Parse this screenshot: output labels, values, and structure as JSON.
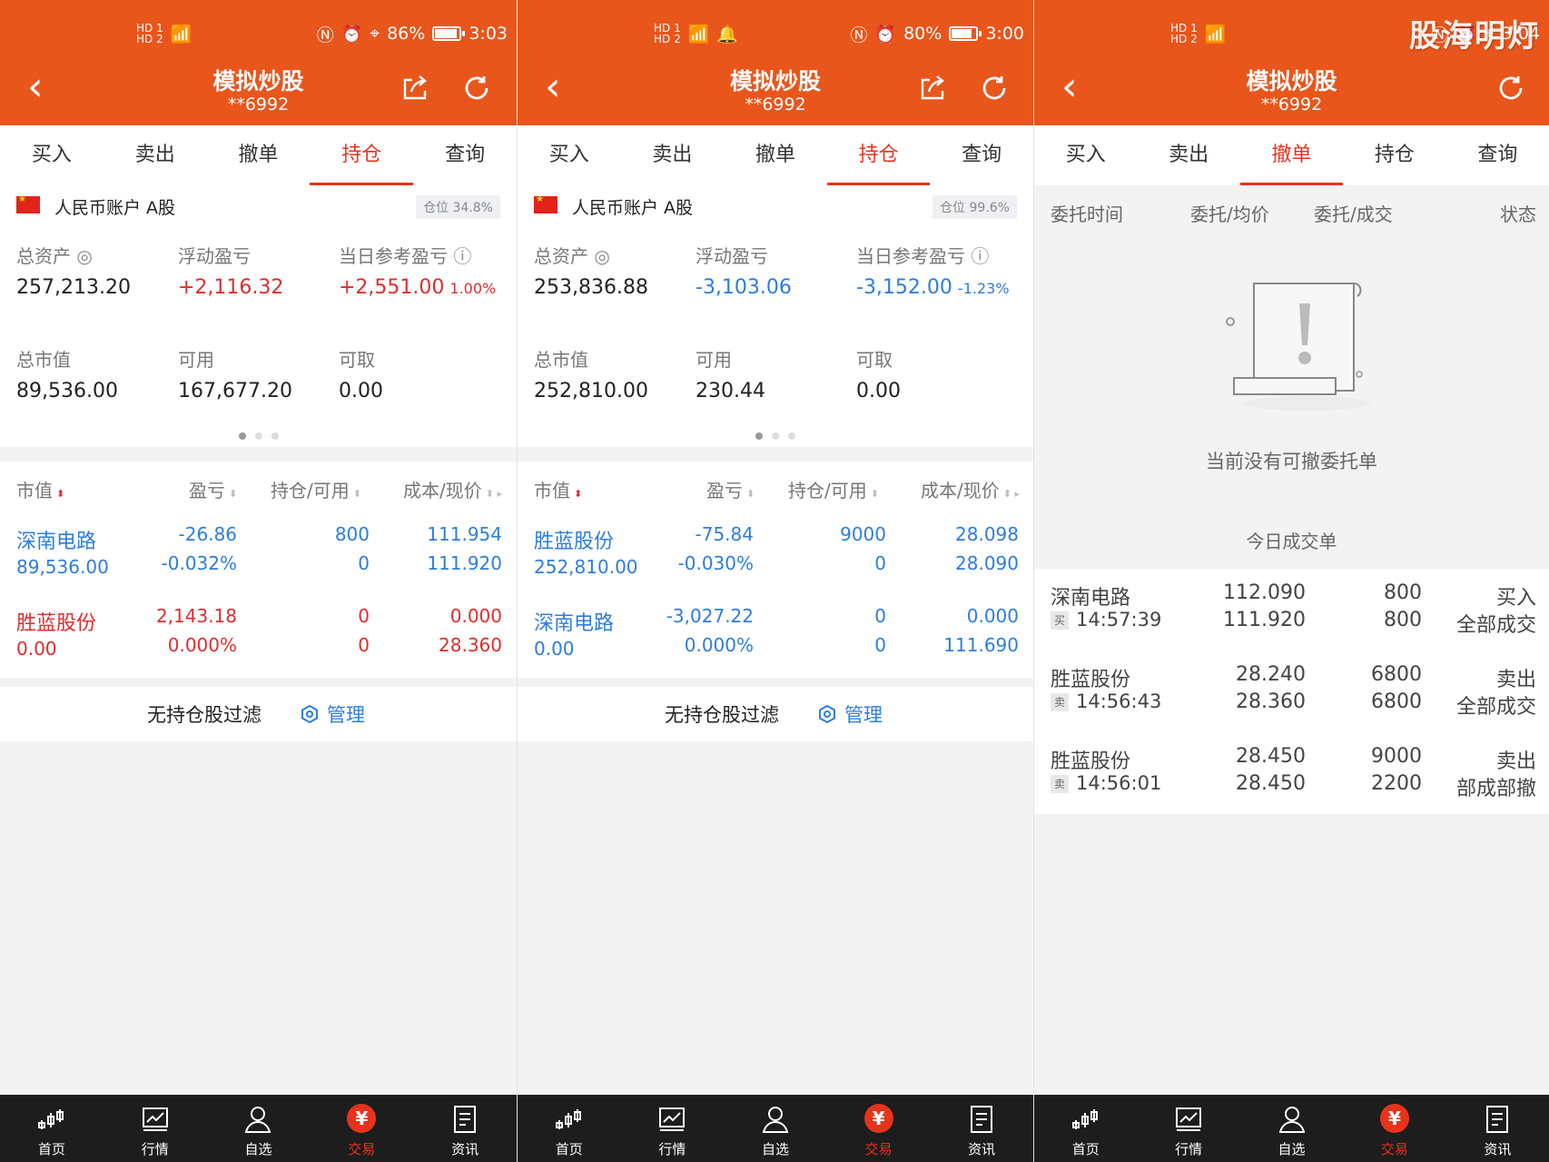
{
  "app": {
    "title": "模拟炒股",
    "account_id": "**6992"
  },
  "tabs": [
    "买入",
    "卖出",
    "撤单",
    "持仓",
    "查询"
  ],
  "bottom_nav": [
    "首页",
    "行情",
    "自选",
    "交易",
    "资讯"
  ],
  "watermark": "股海明灯",
  "colors": {
    "brand": "#e8561c",
    "up": "#e02d2d",
    "down": "#2d7de0"
  },
  "panels": [
    {
      "status": {
        "signal_a": "HD 1",
        "signal_b": "HD 2",
        "battery_text": "86%",
        "battery_level": 0.86,
        "time": "3:03"
      },
      "active_tab": "持仓",
      "account": {
        "name": "人民币账户 A股",
        "position": "仓位 34.8%"
      },
      "summary": {
        "total_assets_label": "总资产",
        "total_assets": "257,213.20",
        "float_pl_label": "浮动盈亏",
        "float_pl": "+2,116.32",
        "daily_pl_label": "当日参考盈亏",
        "daily_pl": "+2,551.00",
        "daily_pct": "1.00%",
        "market_value_label": "总市值",
        "market_value": "89,536.00",
        "available_label": "可用",
        "available": "167,677.20",
        "withdrawable_label": "可取",
        "withdrawable": "0.00"
      },
      "columns": [
        "市值",
        "盈亏",
        "持仓/可用",
        "成本/现价"
      ],
      "rows": [
        {
          "name": "深南电路",
          "value": "89,536.00",
          "pl": "-26.86",
          "pl_pct": "-0.032%",
          "hold": "800",
          "avail": "0",
          "cost": "111.954",
          "price": "111.920",
          "color": "down"
        },
        {
          "name": "胜蓝股份",
          "value": "0.00",
          "pl": "2,143.18",
          "pl_pct": "0.000%",
          "hold": "0",
          "avail": "0",
          "cost": "0.000",
          "price": "28.360",
          "color": "up"
        }
      ],
      "filter_text": "无持仓股过滤",
      "manage_label": "管理"
    },
    {
      "status": {
        "signal_a": "HD 1",
        "signal_b": "HD 2",
        "battery_text": "80%",
        "battery_level": 0.8,
        "time": "3:00"
      },
      "active_tab": "持仓",
      "account": {
        "name": "人民币账户 A股",
        "position": "仓位 99.6%"
      },
      "summary": {
        "total_assets_label": "总资产",
        "total_assets": "253,836.88",
        "float_pl_label": "浮动盈亏",
        "float_pl": "-3,103.06",
        "daily_pl_label": "当日参考盈亏",
        "daily_pl": "-3,152.00",
        "daily_pct": "-1.23%",
        "market_value_label": "总市值",
        "market_value": "252,810.00",
        "available_label": "可用",
        "available": "230.44",
        "withdrawable_label": "可取",
        "withdrawable": "0.00"
      },
      "columns": [
        "市值",
        "盈亏",
        "持仓/可用",
        "成本/现价"
      ],
      "rows": [
        {
          "name": "胜蓝股份",
          "value": "252,810.00",
          "pl": "-75.84",
          "pl_pct": "-0.030%",
          "hold": "9000",
          "avail": "0",
          "cost": "28.098",
          "price": "28.090",
          "color": "down"
        },
        {
          "name": "深南电路",
          "value": "0.00",
          "pl": "-3,027.22",
          "pl_pct": "0.000%",
          "hold": "0",
          "avail": "0",
          "cost": "0.000",
          "price": "111.690",
          "color": "down"
        }
      ],
      "filter_text": "无持仓股过滤",
      "manage_label": "管理"
    },
    {
      "status": {
        "signal_a": "HD 1",
        "signal_b": "HD 2",
        "time": "3:04"
      },
      "active_tab": "撤单",
      "cancel_columns": [
        "委托时间",
        "委托/均价",
        "委托/成交",
        "状态"
      ],
      "empty_text": "当前没有可撤委托单",
      "today_title": "今日成交单",
      "trades": [
        {
          "name": "深南电路",
          "tag": "买",
          "time": "14:57:39",
          "price1": "112.090",
          "price2": "111.920",
          "qty1": "800",
          "qty2": "800",
          "status1": "买入",
          "status2": "全部成交"
        },
        {
          "name": "胜蓝股份",
          "tag": "卖",
          "time": "14:56:43",
          "price1": "28.240",
          "price2": "28.360",
          "qty1": "6800",
          "qty2": "6800",
          "status1": "卖出",
          "status2": "全部成交"
        },
        {
          "name": "胜蓝股份",
          "tag": "卖",
          "time": "14:56:01",
          "price1": "28.450",
          "price2": "28.450",
          "qty1": "9000",
          "qty2": "2200",
          "status1": "卖出",
          "status2": "部成部撤"
        }
      ]
    }
  ]
}
